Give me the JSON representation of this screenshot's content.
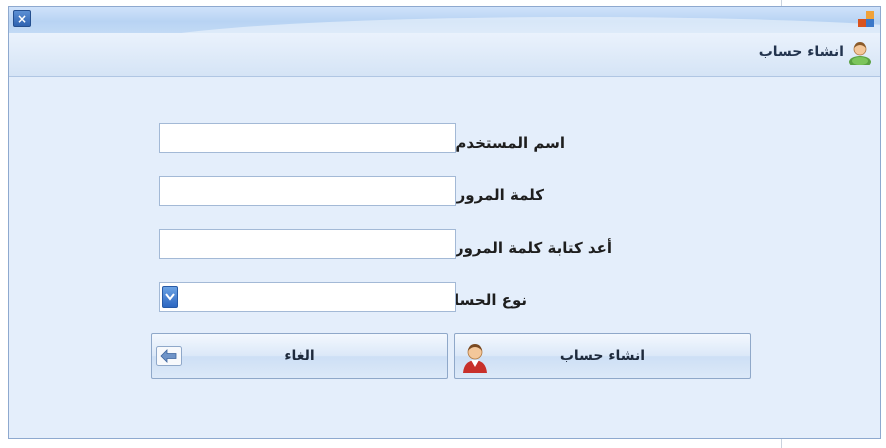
{
  "window": {
    "close_glyph": "×",
    "header_title": "انشاء حساب"
  },
  "form": {
    "username_label": "اسم المستخدم :",
    "username_value": "",
    "password_label": "كلمة المرور :",
    "password_value": "",
    "confirm_label": "أعد كتابة كلمة المرور :",
    "confirm_value": "",
    "account_type_label": "نوع الحساب :",
    "account_type_value": ""
  },
  "buttons": {
    "create_label": "انشاء حساب",
    "cancel_label": "الغاء"
  },
  "icons": {
    "header": "user-icon",
    "create": "person-icon",
    "cancel": "arrow-left-icon",
    "app": "app-icon"
  },
  "colors": {
    "window_bg": "#e4eefb",
    "title_gradient_top": "#cfe2fa",
    "accent": "#2f63b0"
  }
}
